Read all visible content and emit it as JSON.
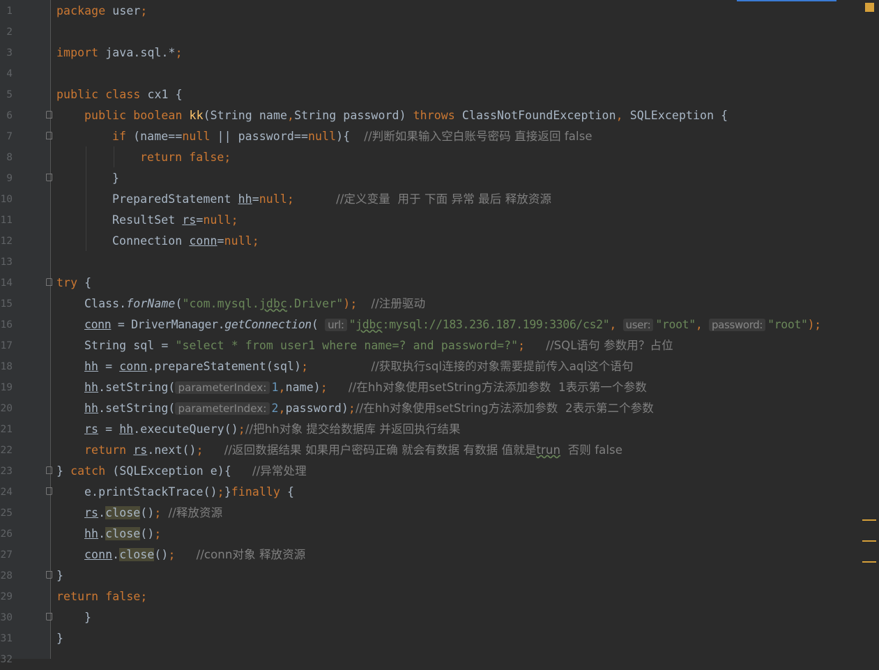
{
  "editor": {
    "line_numbers": [
      "1",
      "2",
      "3",
      "4",
      "5",
      "6",
      "7",
      "8",
      "9",
      "10",
      "11",
      "12",
      "13",
      "14",
      "15",
      "16",
      "17",
      "18",
      "19",
      "20",
      "21",
      "22",
      "23",
      "24",
      "25",
      "26",
      "27",
      "28",
      "29",
      "30",
      "31",
      "32"
    ],
    "icons": {
      "fold_marker": "fold-icon",
      "warning_indicator": "warning-square-icon"
    },
    "colors": {
      "background": "#2b2b2b",
      "keyword": "#cc7832",
      "string": "#6a8759",
      "comment": "#808080",
      "function": "#ffc66d",
      "default": "#a9b7c6",
      "marker": "#d6a03a"
    },
    "code": {
      "l1": {
        "a": "package",
        "b": " user",
        "c": ";"
      },
      "l3": {
        "a": "import",
        "b": " java.sql.*",
        "c": ";"
      },
      "l5": {
        "a": "public class",
        "b": " cx1 {"
      },
      "l6": {
        "a": "public boolean",
        "b": "kk",
        "c": "(String name",
        "d": ",",
        "e": "String password) ",
        "f": "throws",
        "g": " ClassNotFoundException",
        "h": ",",
        "i": " SQLException {"
      },
      "l7": {
        "a": "if",
        "b": " (name==",
        "c": "null",
        "d": " || password==",
        "e": "null",
        "f": "){",
        "g": "//判断如果输入空白账号密码 直接返回 false"
      },
      "l8": {
        "a": "return false;"
      },
      "l9": {
        "a": "}"
      },
      "l10": {
        "a": "PreparedStatement ",
        "b": "hh",
        "c": "=",
        "d": "null;",
        "e": "//定义变量  用于 下面 异常 最后 释放资源"
      },
      "l11": {
        "a": "ResultSet ",
        "b": "rs",
        "c": "=",
        "d": "null;"
      },
      "l12": {
        "a": "Connection ",
        "b": "conn",
        "c": "=",
        "d": "null;"
      },
      "l14": {
        "a": "try",
        "b": " {"
      },
      "l15": {
        "a": "Class.",
        "b": "forName",
        "c": "(",
        "d": "\"com.mysql.",
        "e": "jdbc",
        "f": ".Driver\"",
        "g": ");",
        "h": "//注册驱动"
      },
      "l16": {
        "a": "conn",
        "b": " = DriverManager.",
        "c": "getConnection",
        "d": "(",
        "e": "url:",
        "f": "\"",
        "g": "jdbc",
        "h": ":mysql://183.236.187.199:3306/cs2\"",
        "i": ",",
        "j": "user:",
        "k": "\"root\"",
        "l": ",",
        "m": "password:",
        "n": "\"root\"",
        "o": ");"
      },
      "l17": {
        "a": "String sql = ",
        "b": "\"select * from user1 where name=? and password=?\"",
        "c": ";",
        "d": "//SQL语句 参数用？占位"
      },
      "l18": {
        "a": "hh",
        "b": " = ",
        "c": "conn",
        "d": ".prepareStatement(sql)",
        "e": ";",
        "f": "//获取执行sql连接的对象需要提前传入aql这个语句"
      },
      "l19": {
        "a": "hh",
        "b": ".setString(",
        "c": "parameterIndex:",
        "d": "1",
        "e": ",",
        "f": "name)",
        "g": ";",
        "h": "//在hh对象使用setString方法添加参数  1表示第一个参数"
      },
      "l20": {
        "a": "hh",
        "b": ".setString(",
        "c": "parameterIndex:",
        "d": "2",
        "e": ",",
        "f": "password)",
        "g": ";",
        "h": "//在hh对象使用setString方法添加参数  2表示第二个参数"
      },
      "l21": {
        "a": "rs",
        "b": " = ",
        "c": "hh",
        "d": ".executeQuery()",
        "e": ";",
        "f": "//把hh对象 提交给数据库 并返回执行结果"
      },
      "l22": {
        "a": "return ",
        "b": "rs",
        "c": ".next()",
        "d": ";",
        "e": "//返回数据结果 如果用户密码正确 就会有数据 有数据 值就是",
        "f": "trun",
        "g": "  否则 false"
      },
      "l23": {
        "a": "} ",
        "b": "catch",
        "c": " (SQLException e){",
        "d": "//异常处理"
      },
      "l24": {
        "a": "e.printStackTrace()",
        "b": ";",
        "c": "}",
        "d": "finally",
        "e": " {"
      },
      "l25": {
        "a": "rs",
        "b": ".",
        "c": "close",
        "d": "()",
        "e": ";",
        "f": "//释放资源"
      },
      "l26": {
        "a": "hh",
        "b": ".",
        "c": "close",
        "d": "()",
        "e": ";"
      },
      "l27": {
        "a": "conn",
        "b": ".",
        "c": "close",
        "d": "()",
        "e": ";",
        "f": "//conn对象 释放资源"
      },
      "l28": {
        "a": "}"
      },
      "l29": {
        "a": "return false;"
      },
      "l30": {
        "a": "}"
      },
      "l31": {
        "a": "}"
      }
    }
  }
}
